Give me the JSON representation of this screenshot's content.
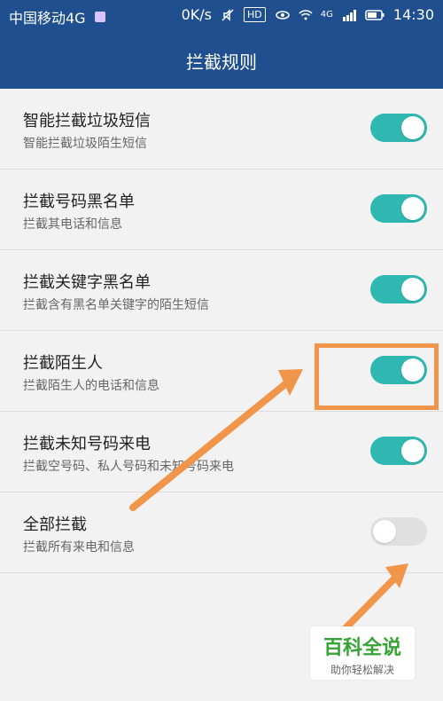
{
  "status_bar": {
    "carrier": "中国移动4G",
    "speed": "0K/s",
    "hd_badge": "HD",
    "network_badge": "4G",
    "time": "14:30",
    "icons": [
      "sim-card-icon",
      "mute-icon",
      "eye-icon",
      "wifi-icon",
      "signal-icon",
      "battery-icon"
    ]
  },
  "app_bar": {
    "title": "拦截规则"
  },
  "settings": {
    "items": [
      {
        "title": "智能拦截垃圾短信",
        "subtitle": "智能拦截垃圾陌生短信",
        "enabled": true
      },
      {
        "title": "拦截号码黑名单",
        "subtitle": "拦截其电话和信息",
        "enabled": true
      },
      {
        "title": "拦截关键字黑名单",
        "subtitle": "拦截含有黑名单关键字的陌生短信",
        "enabled": true
      },
      {
        "title": "拦截陌生人",
        "subtitle": "拦截陌生人的电话和信息",
        "enabled": true
      },
      {
        "title": "拦截未知号码来电",
        "subtitle": "拦截空号码、私人号码和未知号码来电",
        "enabled": true
      },
      {
        "title": "全部拦截",
        "subtitle": "拦截所有来电和信息",
        "enabled": false
      }
    ]
  },
  "annotations": {
    "accent_color": "#f0954a"
  },
  "watermark": {
    "title": "百科全说",
    "subtitle": "助你轻松解决"
  },
  "colors": {
    "header": "#1f4f8f",
    "toggle_on": "#2fb7b1",
    "toggle_off": "#e0e0e0",
    "background": "#f2f2f2"
  }
}
